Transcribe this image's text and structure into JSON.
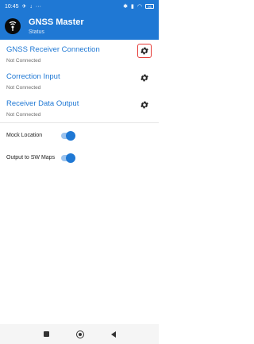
{
  "status_bar": {
    "time": "10:45",
    "battery": "96"
  },
  "app_bar": {
    "title": "GNSS Master",
    "subtitle": "Status"
  },
  "sections": [
    {
      "title": "GNSS Receiver Connection",
      "status": "Not Connected",
      "icon": "gear-icon"
    },
    {
      "title": "Correction Input",
      "status": "Not Connected",
      "icon": "gear-icon"
    },
    {
      "title": "Receiver Data Output",
      "status": "Not Connected",
      "icon": "gear-icon"
    }
  ],
  "toggles": [
    {
      "label": "Mock Location",
      "on": true
    },
    {
      "label": "Output to SW Maps",
      "on": true
    }
  ],
  "colors": {
    "primary": "#1f78d4",
    "highlight": "#e53935"
  }
}
